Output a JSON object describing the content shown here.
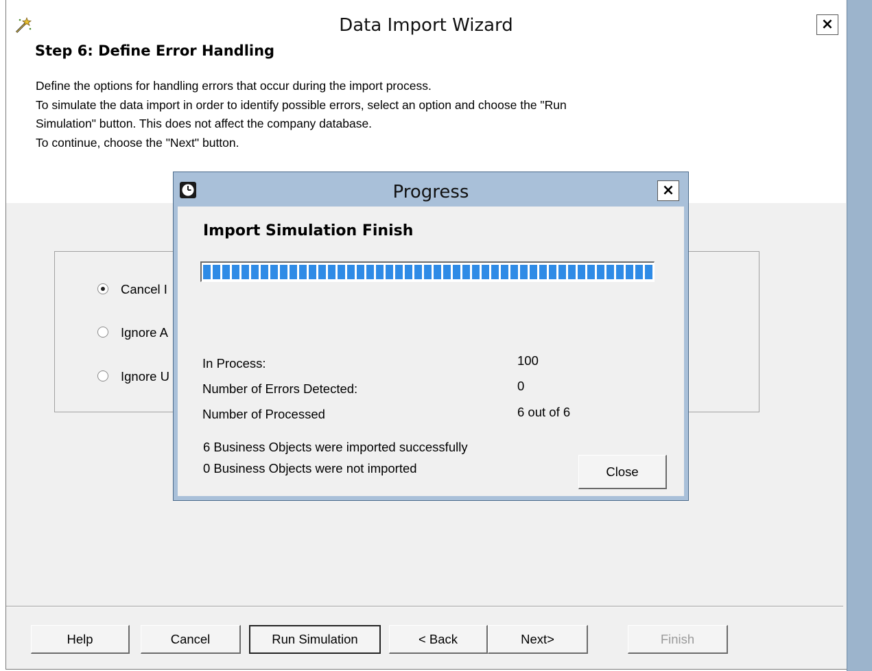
{
  "window": {
    "title": "Data Import Wizard",
    "close_glyph": "×",
    "icon": "wizard-wand-icon"
  },
  "step": {
    "title": "Step 6: Define Error Handling",
    "description": [
      "Define the options for handling errors that occur during the import process.",
      "To simulate the data import in order to identify possible errors, select an option and choose the \"Run",
      "Simulation\" button. This does not affect the company database.",
      "To continue, choose the \"Next\" button."
    ]
  },
  "options": [
    {
      "label": "Cancel I",
      "selected": true
    },
    {
      "label": "Ignore A",
      "selected": false
    },
    {
      "label": "Ignore U",
      "selected": false
    }
  ],
  "buttons": {
    "help": "Help",
    "cancel": "Cancel",
    "run_simulation": "Run Simulation",
    "back": "< Back",
    "next": "Next>",
    "finish": "Finish"
  },
  "progress_dialog": {
    "title": "Progress",
    "icon": "clock-icon",
    "close_glyph": "×",
    "heading": "Import Simulation Finish",
    "progress_fraction": 1.0,
    "stats": [
      {
        "label": "In Process:",
        "value": "100"
      },
      {
        "label": "Number of Errors Detected:",
        "value": "0"
      },
      {
        "label": "Number of Processed",
        "value": "6 out of 6"
      }
    ],
    "messages": [
      "6 Business Objects were imported successfully",
      "0 Business Objects were not imported"
    ],
    "close_button": "Close"
  },
  "colors": {
    "progress_fill": "#2f8be6",
    "dialog_frame": "#a9c0d9",
    "desktop": "#9cb4cc"
  }
}
